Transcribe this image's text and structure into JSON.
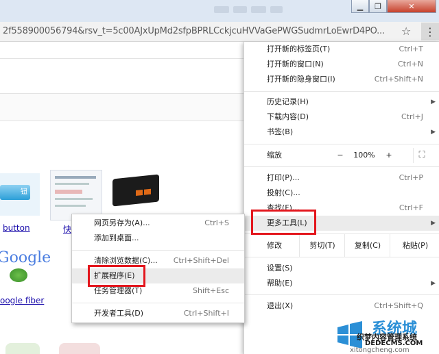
{
  "address_bar": {
    "url": "2f558900056794&rsv_t=5c00AJxUpMd2sfpBPRLCckjcuHVVaGePWGSudmrLoEwrD4PO..."
  },
  "page": {
    "link_button": "button",
    "link_google_fiber": "oogle fiber",
    "link_partial": "快",
    "google_logo_text": "Google"
  },
  "menu": {
    "items": [
      {
        "label": "打开新的标签页(T)",
        "shortcut": "Ctrl+T"
      },
      {
        "label": "打开新的窗口(N)",
        "shortcut": "Ctrl+N"
      },
      {
        "label": "打开新的隐身窗口(I)",
        "shortcut": "Ctrl+Shift+N"
      },
      {
        "label": "历史记录(H)",
        "shortcut": ""
      },
      {
        "label": "下载内容(D)",
        "shortcut": "Ctrl+J"
      },
      {
        "label": "书签(B)",
        "shortcut": ""
      },
      {
        "label": "打印(P)...",
        "shortcut": "Ctrl+P"
      },
      {
        "label": "投射(C)...",
        "shortcut": ""
      },
      {
        "label": "查找(F)...",
        "shortcut": "Ctrl+F"
      },
      {
        "label": "更多工具(L)",
        "shortcut": ""
      },
      {
        "label": "设置(S)",
        "shortcut": ""
      },
      {
        "label": "帮助(E)",
        "shortcut": ""
      },
      {
        "label": "退出(X)",
        "shortcut": "Ctrl+Shift+Q"
      }
    ],
    "zoom": {
      "label": "缩放",
      "minus": "−",
      "value": "100%",
      "plus": "+",
      "fullscreen": "⛶"
    },
    "edit": {
      "label": "修改",
      "cut": "剪切(T)",
      "copy": "复制(C)",
      "paste": "粘贴(P)"
    }
  },
  "submenu": {
    "items": [
      {
        "label": "网页另存为(A)...",
        "shortcut": "Ctrl+S"
      },
      {
        "label": "添加到桌面...",
        "shortcut": ""
      },
      {
        "label": "清除浏览数据(C)...",
        "shortcut": "Ctrl+Shift+Del"
      },
      {
        "label": "扩展程序(E)",
        "shortcut": ""
      },
      {
        "label": "任务管理器(T)",
        "shortcut": "Shift+Esc"
      },
      {
        "label": "开发者工具(D)",
        "shortcut": "Ctrl+Shift+I"
      }
    ]
  },
  "watermark": {
    "brand": "系统城",
    "line1": "织梦内容管理系统",
    "line2": "DEDECMS.COM",
    "line3": "xitongcheng.com"
  },
  "colors": {
    "highlight": "#e3161d",
    "link": "#1a0dab",
    "menu_hover": "#ebebeb"
  }
}
